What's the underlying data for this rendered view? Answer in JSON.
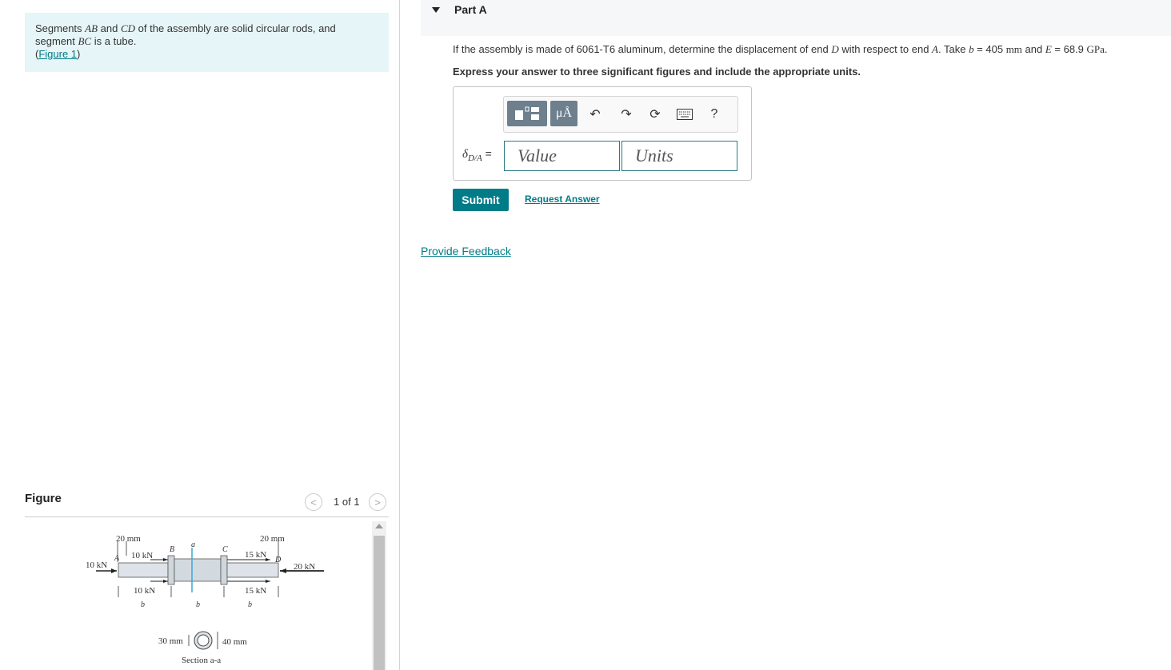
{
  "intro": {
    "text_1": "Segments ",
    "ab": "AB",
    "text_2": " and ",
    "cd": "CD",
    "text_3": " of the assembly are solid circular rods, and segment ",
    "bc": "BC",
    "text_4": " is a tube.",
    "figure_link": "Figure 1"
  },
  "figure": {
    "title": "Figure",
    "pager": "1 of 1",
    "labels": {
      "dim_left": "20 mm",
      "dim_right": "20 mm",
      "load_left": "10 kN",
      "load_right": "20 kN",
      "load_b_top": "10 kN",
      "load_b_bottom": "10 kN",
      "load_c_top": "15 kN",
      "load_c_bottom": "15 kN",
      "pt_a": "A",
      "pt_b": "B",
      "pt_c": "C",
      "pt_d": "D",
      "sec_a": "a",
      "len_1": "b",
      "len_2": "b",
      "len_3": "b",
      "inner_dia": "30 mm",
      "outer_dia": "40 mm",
      "section_caption": "Section a-a"
    }
  },
  "part": {
    "title": "Part A",
    "q1": "If the assembly is made of 6061-T6 aluminum, determine the displacement of end ",
    "d": "D",
    "q2": " with respect to end ",
    "a": "A",
    "q3": ". Take ",
    "b": "b",
    "q4": " = 405 ",
    "mm": "mm",
    "q5": " and ",
    "e": "E",
    "q6": " = 68.9 ",
    "gpa": "GPa",
    "q7": ".",
    "instruction": "Express your answer to three significant figures and include the appropriate units.",
    "symbol": "δ",
    "symbol_sub": "D/A",
    "equals": " =",
    "value_placeholder": "Value",
    "units_placeholder": "Units",
    "mu_label": "μÅ",
    "help_label": "?",
    "submit": "Submit",
    "request": "Request Answer",
    "feedback": "Provide Feedback"
  },
  "colors": {
    "accent": "#007c89",
    "intro_bg": "#e6f5f7",
    "toolbar_dark": "#6e7f8d"
  }
}
